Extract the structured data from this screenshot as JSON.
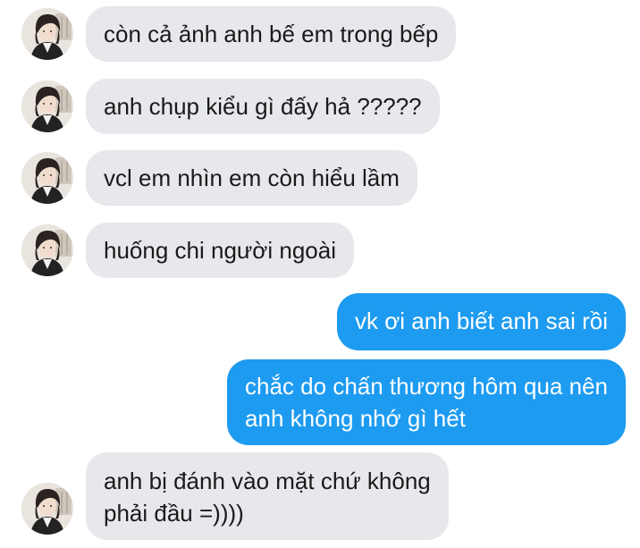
{
  "colors": {
    "incoming_bubble": "#e6e8ec",
    "outgoing_bubble": "#1d9bf0",
    "incoming_text": "#1a1a1a",
    "outgoing_text": "#ffffff"
  },
  "messages": [
    {
      "direction": "incoming",
      "lines": [
        "còn cả ảnh anh bế em trong bếp"
      ]
    },
    {
      "direction": "incoming",
      "lines": [
        "anh chụp kiểu gì đấy hả ?????"
      ]
    },
    {
      "direction": "incoming",
      "lines": [
        "vcl em nhìn em còn hiểu lầm"
      ]
    },
    {
      "direction": "incoming",
      "lines": [
        "huống chi người ngoài"
      ]
    },
    {
      "direction": "outgoing",
      "lines": [
        "vk ơi anh biết anh sai rồi"
      ]
    },
    {
      "direction": "outgoing",
      "lines": [
        "chắc do chấn thương hôm qua nên",
        "anh không nhớ gì hết"
      ]
    },
    {
      "direction": "incoming",
      "lines": [
        "anh bị đánh vào mặt chứ không",
        "phải đầu =))))"
      ]
    }
  ]
}
